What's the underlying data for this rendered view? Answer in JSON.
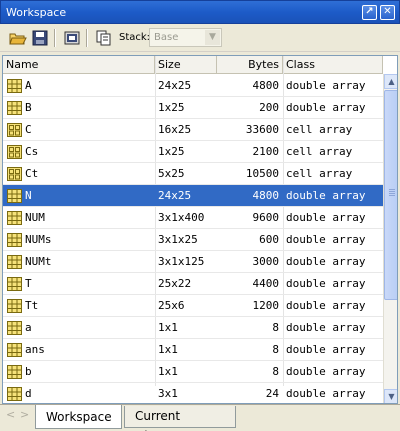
{
  "window": {
    "title": "Workspace"
  },
  "toolbar": {
    "stack_label": "Stack:",
    "stack_value": "Base"
  },
  "columns": {
    "name": "Name",
    "size": "Size",
    "bytes": "Bytes",
    "class": "Class"
  },
  "variables": [
    {
      "name": "A",
      "size": "24x25",
      "bytes": "4800",
      "class": "double array",
      "icon": "matrix-icon"
    },
    {
      "name": "B",
      "size": "1x25",
      "bytes": "200",
      "class": "double array",
      "icon": "matrix-icon"
    },
    {
      "name": "C",
      "size": "16x25",
      "bytes": "33600",
      "class": "cell array",
      "icon": "cell-array-icon"
    },
    {
      "name": "Cs",
      "size": "1x25",
      "bytes": "2100",
      "class": "cell array",
      "icon": "cell-array-icon"
    },
    {
      "name": "Ct",
      "size": "5x25",
      "bytes": "10500",
      "class": "cell array",
      "icon": "cell-array-icon"
    },
    {
      "name": "N",
      "size": "24x25",
      "bytes": "4800",
      "class": "double array",
      "icon": "matrix-icon",
      "selected": true
    },
    {
      "name": "NUM",
      "size": "3x1x400",
      "bytes": "9600",
      "class": "double array",
      "icon": "matrix-icon"
    },
    {
      "name": "NUMs",
      "size": "3x1x25",
      "bytes": "600",
      "class": "double array",
      "icon": "matrix-icon"
    },
    {
      "name": "NUMt",
      "size": "3x1x125",
      "bytes": "3000",
      "class": "double array",
      "icon": "matrix-icon"
    },
    {
      "name": "T",
      "size": "25x22",
      "bytes": "4400",
      "class": "double array",
      "icon": "matrix-icon"
    },
    {
      "name": "Tt",
      "size": "25x6",
      "bytes": "1200",
      "class": "double array",
      "icon": "matrix-icon"
    },
    {
      "name": "a",
      "size": "1x1",
      "bytes": "8",
      "class": "double array",
      "icon": "matrix-icon"
    },
    {
      "name": "ans",
      "size": "1x1",
      "bytes": "8",
      "class": "double array",
      "icon": "matrix-icon"
    },
    {
      "name": "b",
      "size": "1x1",
      "bytes": "8",
      "class": "double array",
      "icon": "matrix-icon"
    },
    {
      "name": "d",
      "size": "3x1",
      "bytes": "24",
      "class": "double array",
      "icon": "matrix-icon"
    }
  ],
  "tabs": {
    "workspace": "Workspace",
    "current_directory": "Current Directory"
  },
  "colors": {
    "selection": "#316ac5",
    "titlebar": "#1d5bc8"
  }
}
